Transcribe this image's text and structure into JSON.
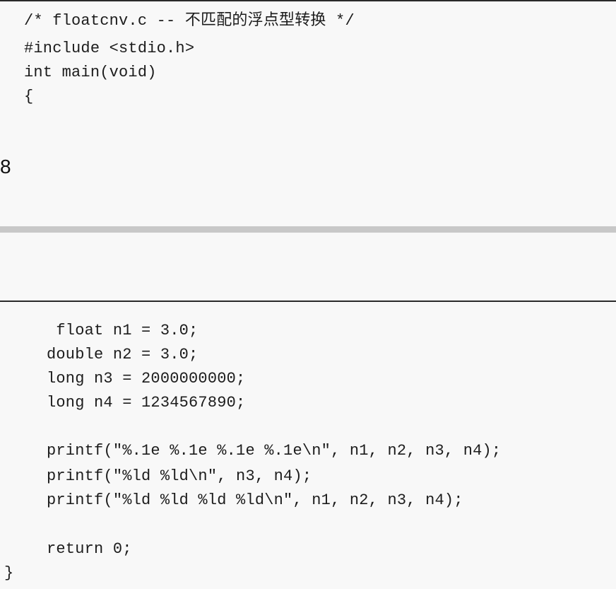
{
  "page_number": "8",
  "code_top": [
    "/* floatcnv.c -- 不匹配的浮点型转换 */",
    "#include <stdio.h>",
    "int main(void)",
    "{"
  ],
  "code_bottom": [
    " float n1 = 3.0;",
    "double n2 = 3.0;",
    "long n3 = 2000000000;",
    "long n4 = 1234567890;",
    "",
    "printf(\"%.1e %.1e %.1e %.1e\\n\", n1, n2, n3, n4);",
    "printf(\"%ld %ld\\n\", n3, n4);",
    "printf(\"%ld %ld %ld %ld\\n\", n1, n2, n3, n4);",
    "",
    "return 0;",
    "}"
  ]
}
